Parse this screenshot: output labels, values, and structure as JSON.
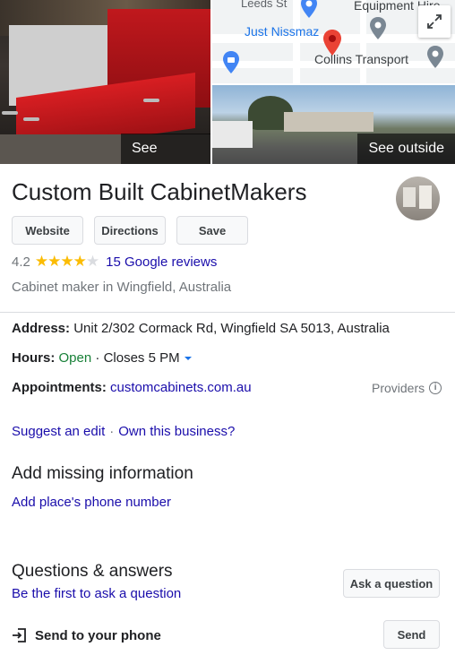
{
  "photos": {
    "see_photos": "See photos",
    "see_outside": "See outside"
  },
  "map": {
    "labels": {
      "street": "Leeds St",
      "equipment": "Equipment Hire",
      "just_nissmaz": "Just Nissmaz",
      "collins": "Collins Transport"
    }
  },
  "business": {
    "name": "Custom Built CabinetMakers",
    "rating": "4.2",
    "stars_filled": 4,
    "stars_total": 5,
    "reviews_link": "15 Google reviews",
    "category": "Cabinet maker in Wingfield, Australia"
  },
  "actions": {
    "website": "Website",
    "directions": "Directions",
    "save": "Save"
  },
  "details": {
    "address_label": "Address:",
    "address_value": "Unit 2/302 Cormack Rd, Wingfield SA 5013, Australia",
    "hours_label": "Hours:",
    "hours_status": "Open",
    "hours_sep": " · ",
    "hours_close": "Closes 5 PM",
    "appointments_label": "Appointments:",
    "appointments_link": "customcabinets.com.au",
    "providers": "Providers"
  },
  "edit": {
    "suggest": "Suggest an edit",
    "sep": "·",
    "own": "Own this business?"
  },
  "missing": {
    "title": "Add missing information",
    "phone_link": "Add place's phone number"
  },
  "qa": {
    "title": "Questions & answers",
    "first_link": "Be the first to ask a question",
    "ask_button": "Ask a question"
  },
  "send": {
    "label": "Send to your phone",
    "button": "Send"
  },
  "colors": {
    "link": "#1a0dab",
    "open": "#188038",
    "star": "#fbbc04",
    "pin": "#ea4335"
  }
}
